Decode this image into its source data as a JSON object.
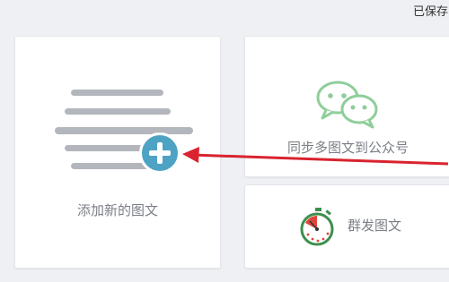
{
  "status": {
    "saved_text": "已保存"
  },
  "cards": {
    "new_article": {
      "label": "添加新的图文"
    },
    "sync": {
      "label": "同步多图文到公众号"
    },
    "mass_send": {
      "label": "群发图文"
    }
  },
  "icons": {
    "plus": "add-icon",
    "wechat": "wechat-icon",
    "stopwatch": "stopwatch-icon",
    "document_lines": "document-lines-icon"
  },
  "colors": {
    "accent_blue": "#4ea3c4",
    "wechat_green": "#8fce9a",
    "annotation_red": "#d9232f",
    "stopwatch_red": "#e0453a"
  }
}
